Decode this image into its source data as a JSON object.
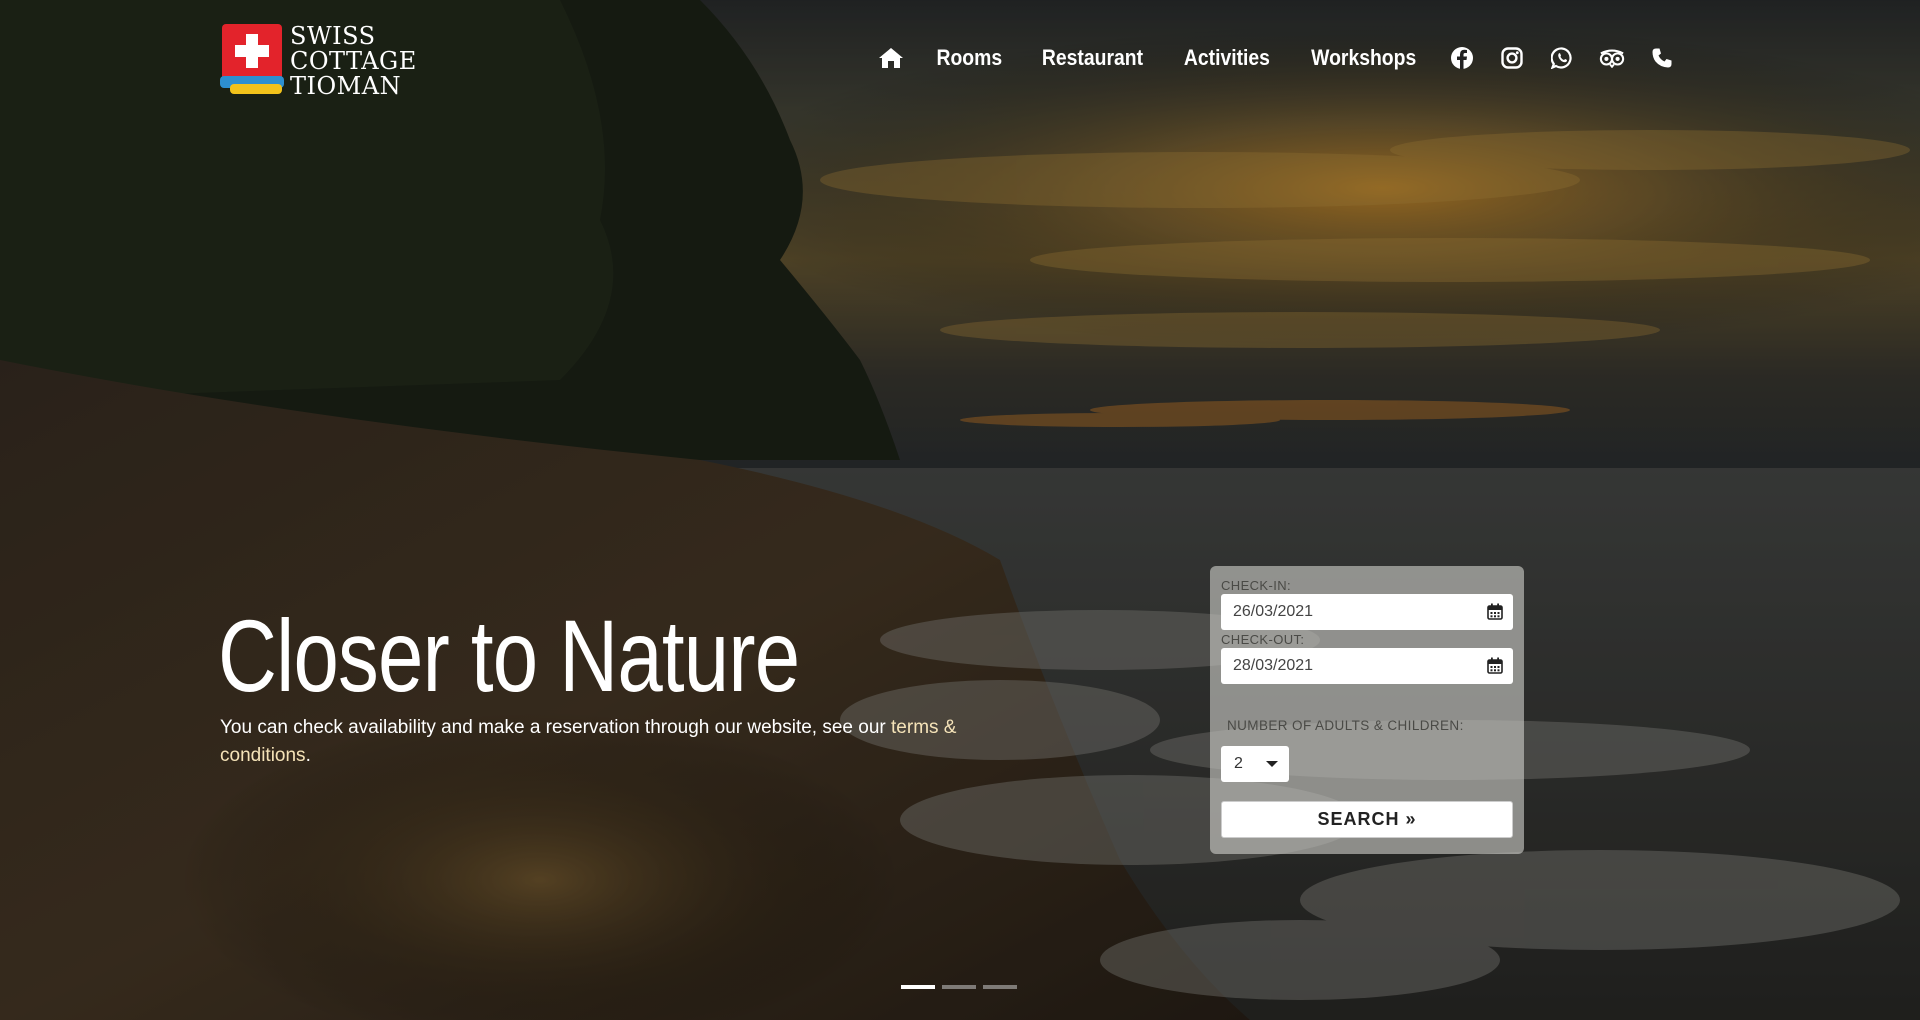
{
  "site": {
    "logo_lines": [
      "SWISS",
      "COTTAGE",
      "TIOMAN"
    ]
  },
  "nav": {
    "home_icon": "home-icon",
    "items": [
      {
        "label": "Rooms"
      },
      {
        "label": "Restaurant"
      },
      {
        "label": "Activities"
      },
      {
        "label": "Workshops"
      }
    ],
    "social_icons": [
      "facebook-icon",
      "instagram-icon",
      "whatsapp-icon",
      "tripadvisor-icon",
      "phone-icon"
    ]
  },
  "hero": {
    "title": "Closer to Nature",
    "subtitle": "You can check availability and make a reservation through our website, see our",
    "terms_link": "terms & conditions",
    "subtitle_end": "."
  },
  "booking": {
    "checkin_label": "CHECK-IN:",
    "checkin_value": "26/03/2021",
    "checkout_label": "CHECK-OUT:",
    "checkout_value": "28/03/2021",
    "guests_label": "NUMBER OF ADULTS & CHILDREN:",
    "guests_value": "2",
    "search_label": "SEARCH »"
  },
  "slider": {
    "slides": 3,
    "active_slide": 1
  },
  "colors": {
    "link_accent": "#f5e3b8",
    "logo_red": "#e3232b",
    "logo_blue": "#2d8fd0",
    "logo_yellow": "#f2c21b"
  }
}
